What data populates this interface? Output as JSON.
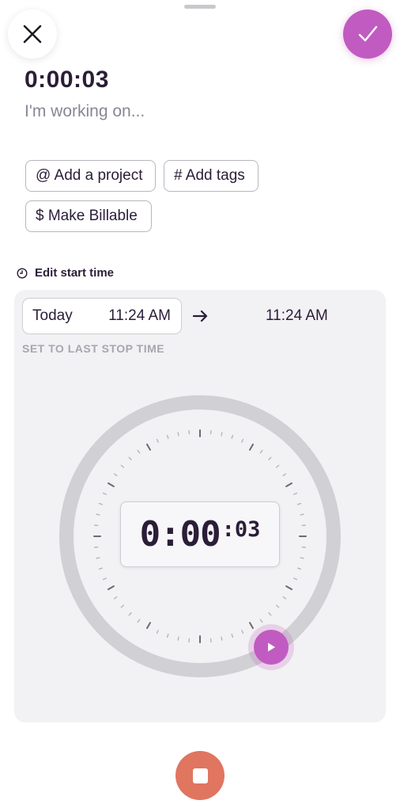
{
  "header": {
    "close_icon": "x-icon",
    "confirm_icon": "checkmark-icon"
  },
  "entry": {
    "duration": "0:00:03",
    "description_placeholder": "I'm working on..."
  },
  "chips": {
    "project_label": "@ Add a project",
    "tags_label": "# Add tags",
    "billable_label": "$ Make Billable"
  },
  "edit_start": {
    "label": "Edit start time",
    "icon": "clock-icon"
  },
  "time_range": {
    "start_day": "Today",
    "start_time": "11:24 AM",
    "arrow_icon": "arrow-right-icon",
    "stop_time": "11:24 AM",
    "set_last_label": "SET TO LAST STOP TIME"
  },
  "dial": {
    "time_main": "0:00",
    "time_seconds": ":03",
    "handle_icon": "play-icon"
  },
  "footer": {
    "stop_icon": "stop-icon"
  },
  "colors": {
    "accent": "#c15bc1",
    "stop": "#e07560",
    "text": "#2b1d38",
    "panel": "#f2f1f4"
  }
}
